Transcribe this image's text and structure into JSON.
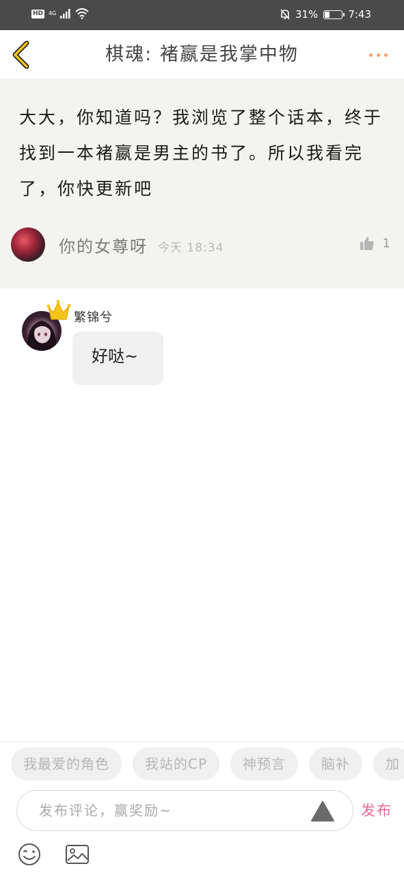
{
  "status_bar": {
    "hd": "HD",
    "network": "4G",
    "battery_text": "31%",
    "battery_level": 0.31,
    "time": "7:43"
  },
  "header": {
    "title": "棋魂: 褚嬴是我掌中物",
    "back_icon": "chevron-left-icon",
    "more_icon": "more-dots-icon",
    "accent_color": "#f5c518"
  },
  "comment": {
    "text": "大大，你知道吗？我浏览了整个话本，终于找到一本褚嬴是男主的书了。所以我看完了，你快更新吧",
    "author": "你的女尊呀",
    "time": "今天 18:34",
    "likes": "1"
  },
  "reply": {
    "author": "繁锦兮",
    "text": "好哒~",
    "badge_icon": "crown-icon"
  },
  "quick_tags": [
    "我最爱的角色",
    "我站的CP",
    "神预言",
    "脑补",
    "加"
  ],
  "composer": {
    "placeholder": "发布评论，赢奖励~",
    "publish_label": "发布",
    "publish_color": "#ea6590"
  },
  "toolbar": {
    "emoji_icon": "emoji-icon",
    "image_icon": "image-icon"
  }
}
